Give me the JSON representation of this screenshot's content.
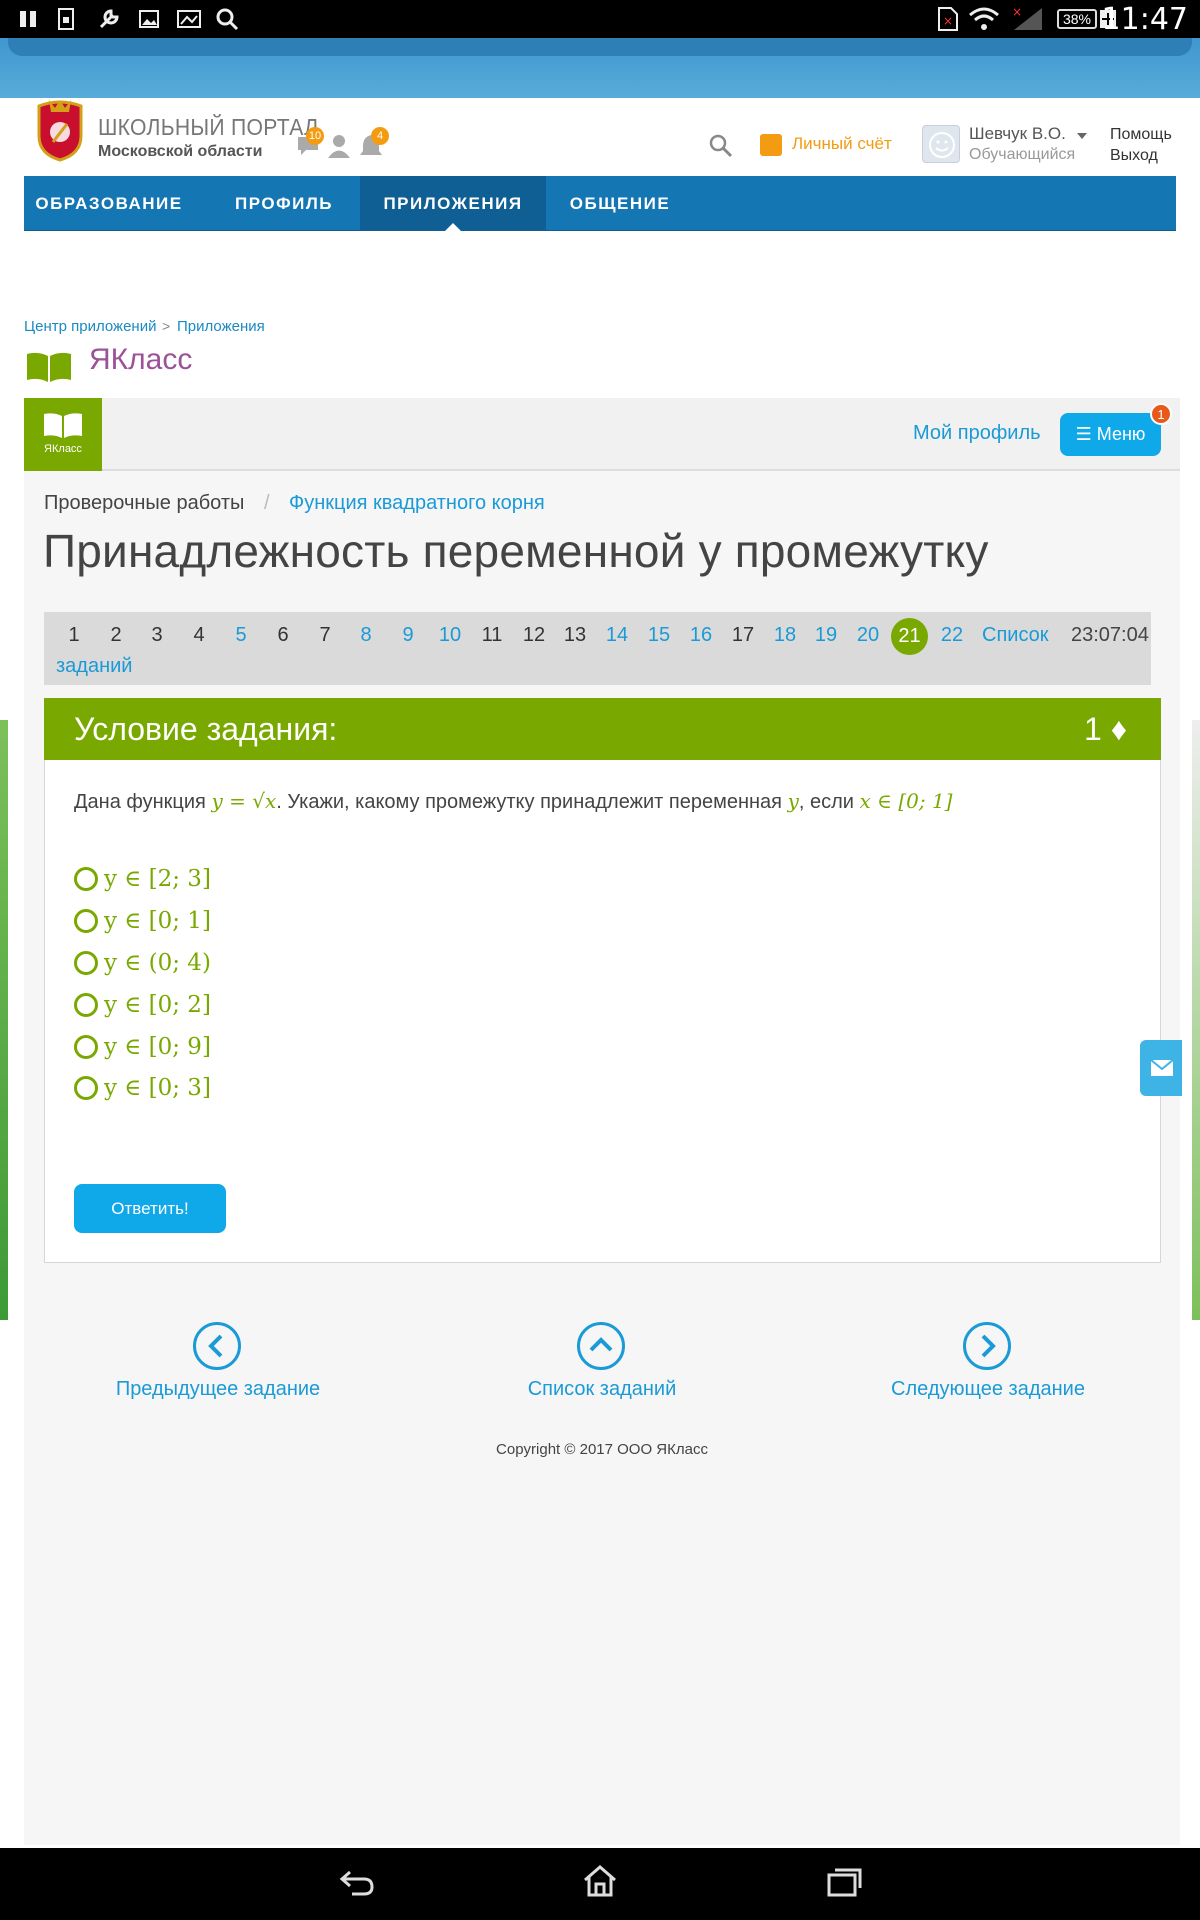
{
  "status_bar": {
    "battery": "38%",
    "time": "11:47"
  },
  "header": {
    "portal_title": "ШКОЛЬНЫЙ ПОРТАЛ",
    "portal_subtitle": "Московской области",
    "messages_count": "10",
    "notifications_count": "4",
    "account_label": "Личный счёт",
    "user_name": "Шевчук В.О.",
    "user_role": "Обучающийся",
    "help_label": "Помощь",
    "logout_label": "Выход"
  },
  "nav": {
    "items": [
      {
        "label": "ОБРАЗОВАНИЕ"
      },
      {
        "label": "ПРОФИЛЬ"
      },
      {
        "label": "ПРИЛОЖЕНИЯ"
      },
      {
        "label": "ОБЩЕНИЕ"
      }
    ],
    "active_index": 2
  },
  "app_breadcrumb": {
    "center": "Центр приложений",
    "separator": ">",
    "apps": "Приложения"
  },
  "app": {
    "title": "ЯКласс",
    "logo_caption": "ЯКласс",
    "my_profile": "Мой профиль",
    "menu_label": "Меню",
    "menu_badge": "1"
  },
  "breadcrumb": {
    "level1": "Проверочные работы",
    "separator": "/",
    "level2": "Функция квадратного корня"
  },
  "page_title": "Принадлежность переменной y промежутку",
  "pager": {
    "tasks": [
      {
        "n": "1",
        "state": "done"
      },
      {
        "n": "2",
        "state": "done"
      },
      {
        "n": "3",
        "state": "done"
      },
      {
        "n": "4",
        "state": "done"
      },
      {
        "n": "5",
        "state": "link"
      },
      {
        "n": "6",
        "state": "done"
      },
      {
        "n": "7",
        "state": "done"
      },
      {
        "n": "8",
        "state": "link"
      },
      {
        "n": "9",
        "state": "link"
      },
      {
        "n": "10",
        "state": "link"
      },
      {
        "n": "11",
        "state": "done"
      },
      {
        "n": "12",
        "state": "done"
      },
      {
        "n": "13",
        "state": "done"
      },
      {
        "n": "14",
        "state": "link"
      },
      {
        "n": "15",
        "state": "link"
      },
      {
        "n": "16",
        "state": "link"
      },
      {
        "n": "17",
        "state": "done"
      },
      {
        "n": "18",
        "state": "link"
      },
      {
        "n": "19",
        "state": "link"
      },
      {
        "n": "20",
        "state": "link"
      },
      {
        "n": "21",
        "state": "current"
      },
      {
        "n": "22",
        "state": "link"
      }
    ],
    "list_label_line1": "Список",
    "list_label_line2": "заданий",
    "timer": "23:07:04"
  },
  "task": {
    "header": "Условие задания:",
    "points": "1",
    "q_prefix": "Дана функция ",
    "q_func": "y = √x",
    "q_middle": ". Укажи, какому промежутку принадлежит переменная ",
    "q_var": "y",
    "q_if": ", если ",
    "q_cond": "x ∈ [0; 1]",
    "options": [
      "y ∈ [2; 3]",
      "y ∈ [0; 1]",
      "y ∈ (0; 4)",
      "y ∈ [0; 2]",
      "y ∈ [0; 9]",
      "y ∈ [0; 3]"
    ],
    "answer_button": "Ответить!"
  },
  "bottom_nav": {
    "prev": "Предыдущее задание",
    "list": "Список заданий",
    "next": "Следующее задание"
  },
  "copyright": "Copyright © 2017 ООО ЯКласс"
}
